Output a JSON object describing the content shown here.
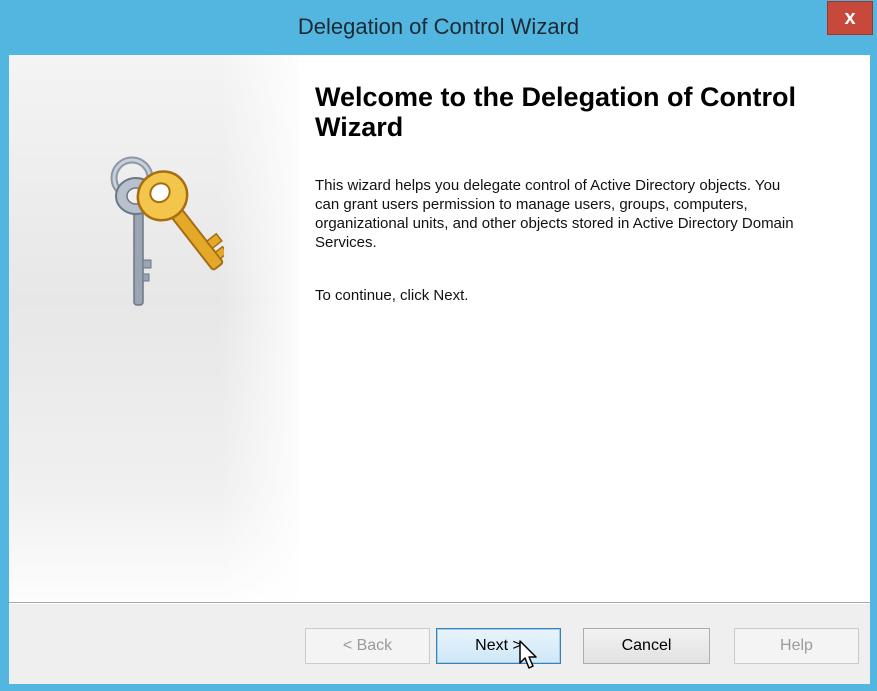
{
  "window": {
    "title": "Delegation of Control Wizard",
    "close_label": "x"
  },
  "content": {
    "heading": "Welcome to the Delegation of Control Wizard",
    "description": "This wizard helps you delegate control of Active Directory objects. You can grant users permission to manage users, groups, computers, organizational units, and other objects stored in Active Directory Domain Services.",
    "continue_text": "To continue, click Next."
  },
  "buttons": {
    "back": "< Back",
    "next": "Next >",
    "cancel": "Cancel",
    "help": "Help"
  },
  "icons": {
    "banner": "keys-icon",
    "pointer": "mouse-cursor-icon"
  },
  "colors": {
    "window_frame": "#52b6e0",
    "close_button": "#c6493c",
    "next_button_border": "#3c7fb1"
  }
}
